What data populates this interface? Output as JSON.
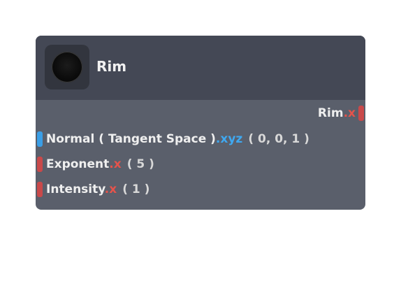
{
  "node": {
    "title": "Rim",
    "preview_icon": "black-sphere-preview",
    "outputs": [
      {
        "name": "Rim",
        "swizzle": ".x",
        "type_color": "#c9494a"
      }
    ],
    "inputs": [
      {
        "name": "Normal ( Tangent Space )",
        "swizzle": ".xyz",
        "default": "( 0, 0, 1 )",
        "type_color": "#3a9ee6"
      },
      {
        "name": "Exponent",
        "swizzle": ".x",
        "default": "( 5 )",
        "type_color": "#c9494a"
      },
      {
        "name": "Intensity",
        "swizzle": ".x",
        "default": "( 1 )",
        "type_color": "#c9494a"
      }
    ]
  },
  "colors": {
    "header_bg": "#444855",
    "body_bg": "#5a5f6b",
    "float_swizzle": "#e5534b",
    "vector_swizzle": "#3fa8f0"
  }
}
